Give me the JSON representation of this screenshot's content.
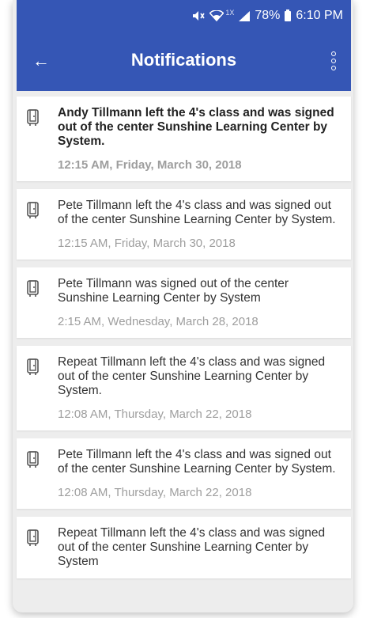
{
  "status_bar": {
    "battery": "78%",
    "time": "6:10 PM",
    "lte": "1X"
  },
  "header": {
    "title": "Notifications"
  },
  "notifications": [
    {
      "text": "Andy Tillmann left the 4's class and was signed out of the center Sunshine Learning Center by System.",
      "time": "12:15 AM, Friday, March 30, 2018",
      "unread": true
    },
    {
      "text": "Pete Tillmann left the 4's class and was signed out of the center Sunshine Learning Center by System.",
      "time": "12:15 AM, Friday, March 30, 2018",
      "unread": false
    },
    {
      "text": "Pete Tillmann was signed out of the center Sunshine Learning Center by System",
      "time": "2:15 AM, Wednesday, March 28, 2018",
      "unread": false
    },
    {
      "text": "Repeat Tillmann left the 4's class and was signed out of the center Sunshine Learning Center by System.",
      "time": "12:08 AM, Thursday, March 22, 2018",
      "unread": false
    },
    {
      "text": "Pete Tillmann left the 4's class and was signed out of the center Sunshine Learning Center by System.",
      "time": "12:08 AM, Thursday, March 22, 2018",
      "unread": false
    },
    {
      "text": "Repeat Tillmann left the 4's class and was signed out of the center Sunshine Learning Center by System",
      "time": "",
      "unread": false
    }
  ],
  "colors": {
    "appbar": "#3556b5",
    "background": "#ededed",
    "timestamp": "#9e9e9e"
  },
  "icons": {
    "back": "arrow-left-icon",
    "more": "more-vertical-icon",
    "notification": "door-exit-icon"
  }
}
